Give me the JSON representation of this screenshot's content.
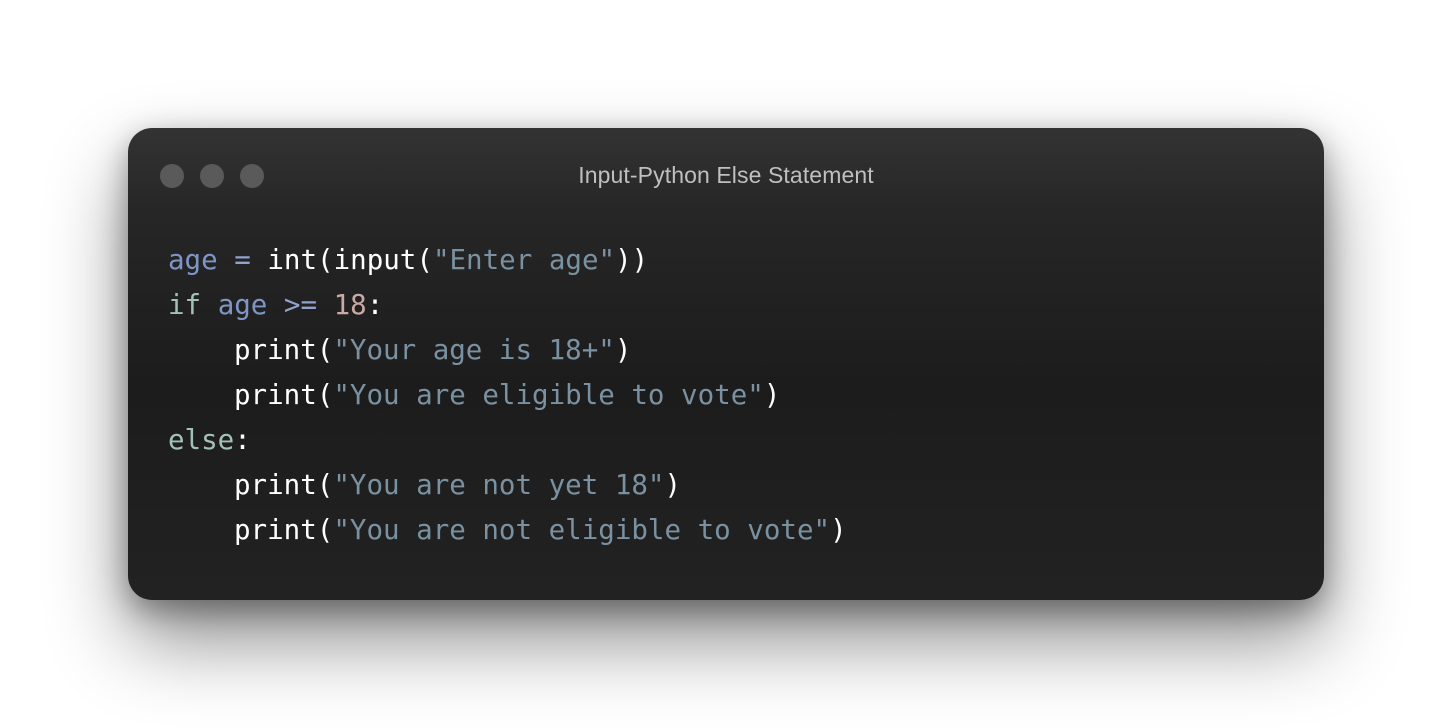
{
  "window": {
    "title": "Input-Python Else Statement",
    "controls": [
      "window-control-dot",
      "window-control-dot",
      "window-control-dot"
    ]
  },
  "code": {
    "language": "python",
    "lines": [
      {
        "indent": 0,
        "tokens": [
          {
            "type": "var",
            "text": "age"
          },
          {
            "type": "op",
            "text": " = "
          },
          {
            "type": "fn",
            "text": "int"
          },
          {
            "type": "pun",
            "text": "("
          },
          {
            "type": "fn",
            "text": "input"
          },
          {
            "type": "pun",
            "text": "("
          },
          {
            "type": "str",
            "text": "\"Enter age\""
          },
          {
            "type": "pun",
            "text": "))"
          }
        ]
      },
      {
        "indent": 0,
        "tokens": [
          {
            "type": "kw",
            "text": "if"
          },
          {
            "type": "op",
            "text": " "
          },
          {
            "type": "var",
            "text": "age"
          },
          {
            "type": "op",
            "text": " >= "
          },
          {
            "type": "num",
            "text": "18"
          },
          {
            "type": "pun",
            "text": ":"
          }
        ]
      },
      {
        "indent": 1,
        "tokens": [
          {
            "type": "fn",
            "text": "print"
          },
          {
            "type": "pun",
            "text": "("
          },
          {
            "type": "str",
            "text": "\"Your age is 18+\""
          },
          {
            "type": "pun",
            "text": ")"
          }
        ]
      },
      {
        "indent": 1,
        "tokens": [
          {
            "type": "fn",
            "text": "print"
          },
          {
            "type": "pun",
            "text": "("
          },
          {
            "type": "str",
            "text": "\"You are eligible to vote\""
          },
          {
            "type": "pun",
            "text": ")"
          }
        ]
      },
      {
        "indent": 0,
        "tokens": [
          {
            "type": "kw",
            "text": "else"
          },
          {
            "type": "pun",
            "text": ":"
          }
        ]
      },
      {
        "indent": 1,
        "tokens": [
          {
            "type": "fn",
            "text": "print"
          },
          {
            "type": "pun",
            "text": "("
          },
          {
            "type": "str",
            "text": "\"You are not yet 18\""
          },
          {
            "type": "pun",
            "text": ")"
          }
        ]
      },
      {
        "indent": 1,
        "tokens": [
          {
            "type": "fn",
            "text": "print"
          },
          {
            "type": "pun",
            "text": "("
          },
          {
            "type": "str",
            "text": "\"You are not eligible to vote\""
          },
          {
            "type": "pun",
            "text": ")"
          }
        ]
      }
    ]
  },
  "colors": {
    "window_background": "#1c1c1c",
    "titlebar_text": "#bfbfbf",
    "window_control": "#5a5a5a",
    "variable": "#7f95c6",
    "keyword": "#a3c2b6",
    "number": "#c9a9a6",
    "string": "#7a91a1",
    "function": "#ffffff"
  }
}
